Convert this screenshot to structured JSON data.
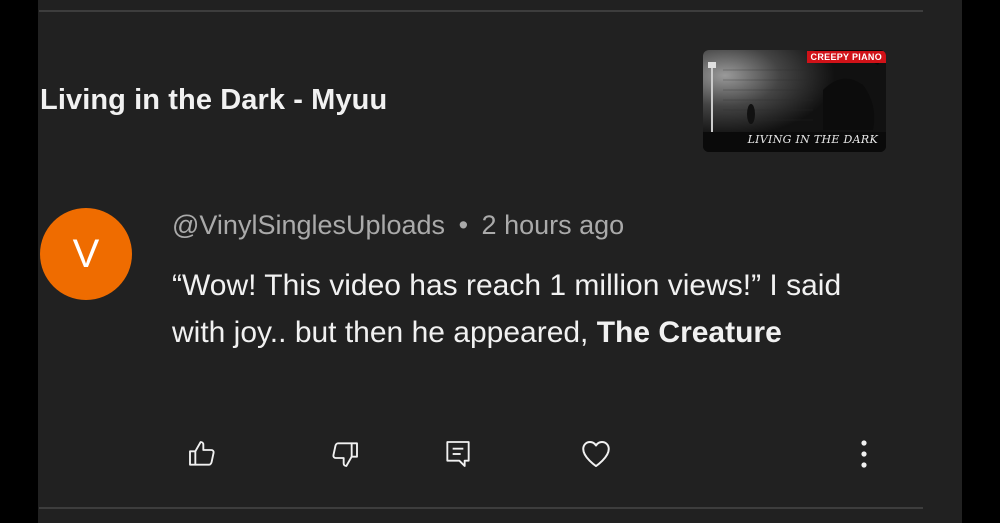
{
  "video": {
    "title": "Living in the Dark - Myuu",
    "thumbnail": {
      "badge": "CREEPY PIANO",
      "caption": "LIVING IN THE DARK"
    }
  },
  "comment": {
    "avatar_letter": "V",
    "avatar_color": "#ef6c00",
    "author": "@VinylSinglesUploads",
    "separator": "•",
    "time": "2 hours ago",
    "text_plain": "“Wow! This video has reach 1 million views!” I said with joy.. but then he appeared, ",
    "text_bold": "The Creature"
  },
  "actions": {
    "like_icon": "thumbs-up-icon",
    "dislike_icon": "thumbs-down-icon",
    "reply_icon": "reply-comment-icon",
    "heart_icon": "heart-icon",
    "more_icon": "vertical-dots-icon"
  }
}
